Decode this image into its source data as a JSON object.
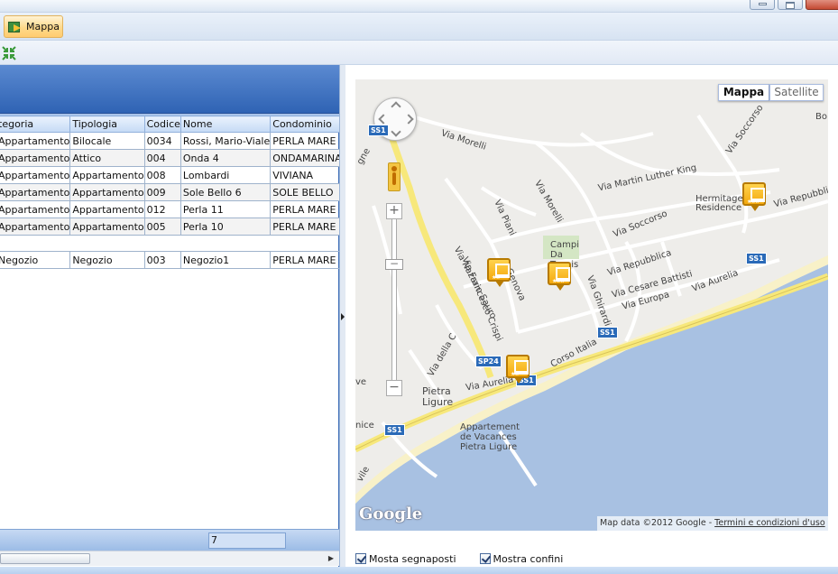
{
  "ribbon": {
    "tab_label": "Mappa"
  },
  "grid": {
    "columns": [
      "tegoria",
      "Tipologia",
      "Codice",
      "Nome",
      "Condominio"
    ],
    "rows": [
      [
        "Appartamento",
        "Bilocale",
        "0034",
        "Rossi, Mario-Viale",
        "PERLA MARE"
      ],
      [
        "Appartamento",
        "Attico",
        "004",
        "Onda 4",
        "ONDAMARINA"
      ],
      [
        "Appartamento",
        "Appartamento",
        "008",
        "Lombardi",
        "VIVIANA"
      ],
      [
        "Appartamento",
        "Appartamento",
        "009",
        "Sole Bello 6",
        "SOLE BELLO"
      ],
      [
        "Appartamento",
        "Appartamento",
        "012",
        "Perla 11",
        "PERLA MARE"
      ],
      [
        "Appartamento",
        "Appartamento",
        "005",
        "Perla 10",
        "PERLA MARE"
      ]
    ],
    "group_rows": [
      [
        "Negozio",
        "Negozio",
        "003",
        "Negozio1",
        "PERLA MARE"
      ]
    ],
    "footer_count": "7"
  },
  "map": {
    "type_buttons": {
      "map": "Mappa",
      "satellite": "Satellite"
    },
    "attribution": "Map data ©2012 Google - ",
    "attribution_link": "Termini e condizioni d'uso",
    "logo": "Google",
    "labels": {
      "via_morelli": "Via Morelli",
      "via_mlk": "Via Martin Luther King",
      "via_soccorso_top": "Via Soccorso",
      "via_soccorso": "Via Soccorso",
      "hermitage": "Hermitage Residence",
      "via_repubblica_right": "Via Repubblica",
      "via_repubblica": "Via Repubblica",
      "via_piani": "Via Piani",
      "via_morelli2": "Via Morelli",
      "campi": "Campi Da Tennis",
      "via_cesare": "Via Cesare Battisti",
      "via_europa": "Via Europa",
      "via_ghirardi": "Via Ghirardi",
      "via_aurelia_right": "Via Aurelia",
      "via_nazario": "Via Nazario Sauro",
      "via_crispi": "Via Francesco Crispi",
      "via_genova": "Genova",
      "via_della_c": "Via della C",
      "corso_italia": "Corso Italia",
      "via_aurelia": "Via Aurelia",
      "pietra": "Pietra Ligure",
      "appartement": "Appartement de Vacances Pietra Ligure",
      "nice": "nice",
      "vile": "vile",
      "gne": "gne",
      "ve": "ve",
      "bo": "Bo",
      "sp24": "SP24",
      "ss1": "SS1"
    }
  },
  "options": {
    "show_markers": "Mosta segnaposti",
    "show_borders": "Mostra confini"
  },
  "colors": {
    "grid_header": "#3366b5",
    "tab_active": "#ffd98b",
    "water": "#a8c1e2",
    "highway": "#f7e87b",
    "marker": "#f4a90e"
  }
}
